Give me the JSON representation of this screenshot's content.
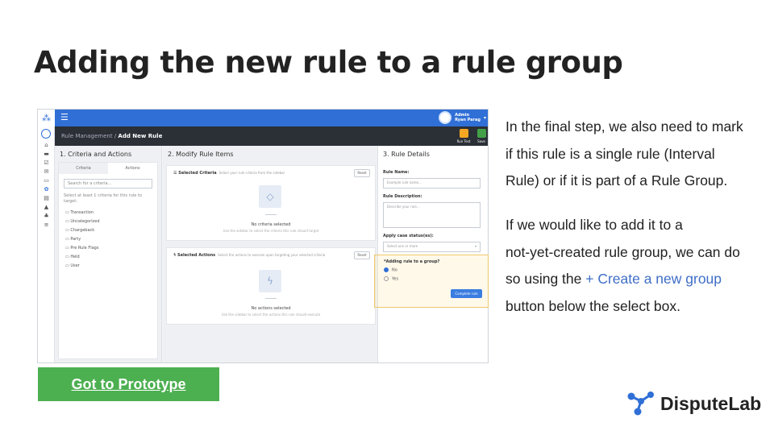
{
  "slide": {
    "title": "Adding the new rule to a rule group"
  },
  "app": {
    "user": {
      "role": "Admin",
      "name": "Ryan Parag"
    },
    "breadcrumb": {
      "parent": "Rule Management",
      "separator": "/",
      "current": "Add New Rule"
    },
    "actions": {
      "run_test": "Run Test",
      "save": "Save"
    },
    "sidebar_icons": [
      "home-icon",
      "briefcase-icon",
      "checkbox-icon",
      "mail-icon",
      "card-icon",
      "settings-icon",
      "file-icon",
      "alert-icon",
      "users-icon",
      "sliders-icon"
    ],
    "columns": {
      "criteria": {
        "heading": "1. Criteria and Actions",
        "tabs": [
          "Criteria",
          "Actions"
        ],
        "search_placeholder": "Search for a criteria...",
        "hint": "Select at least 1 criteria for this rule to target:",
        "categories": [
          "Transaction",
          "Uncategorized",
          "Chargeback",
          "Party",
          "Pre Rule Flags",
          "Held",
          "User"
        ]
      },
      "modify": {
        "heading": "2. Modify Rule Items",
        "selected_criteria": {
          "title": "Selected Criteria",
          "subtitle": "Select your rule criteria from the sidebar",
          "reset": "Reset",
          "empty_title": "No criteria selected",
          "empty_sub": "Use the sidebar to select the criteria this rule should target"
        },
        "selected_actions": {
          "title": "Selected Actions",
          "subtitle": "Select the actions to execute upon targeting your selected criteria",
          "reset": "Reset",
          "empty_title": "No actions selected",
          "empty_sub": "Use the sidebar to select the actions this rule should execute"
        }
      },
      "details": {
        "heading": "3. Rule Details",
        "rule_name_label": "Rule Name:",
        "rule_name_placeholder": "Example rule name...",
        "rule_desc_label": "Rule Description:",
        "rule_desc_placeholder": "Describe your rule...",
        "case_status_label": "Apply case status(es):",
        "case_status_value": "Select one or more",
        "group_question": "*Adding rule to a group?",
        "options": [
          "No",
          "Yes"
        ],
        "selected_option": "No",
        "complete_button": "Complete rule"
      }
    }
  },
  "description": {
    "para1_lines": [
      "In the final step, we also need to mark",
      "if this rule is a single rule (Interval",
      "Rule) or if it is part of a Rule Group."
    ],
    "para2_lines": [
      "If we would like to add it to a",
      "not-yet-created rule group, we can do"
    ],
    "line_prefix": "so using the ",
    "link_text": "+ Create a new group",
    "last_line": "button below the select box."
  },
  "prototype_button": "Got to Prototype",
  "brand": {
    "name": "DisputeLab",
    "colors": {
      "primary": "#2f6fd6",
      "dark": "#2b2f36",
      "green": "#4caf50"
    }
  }
}
